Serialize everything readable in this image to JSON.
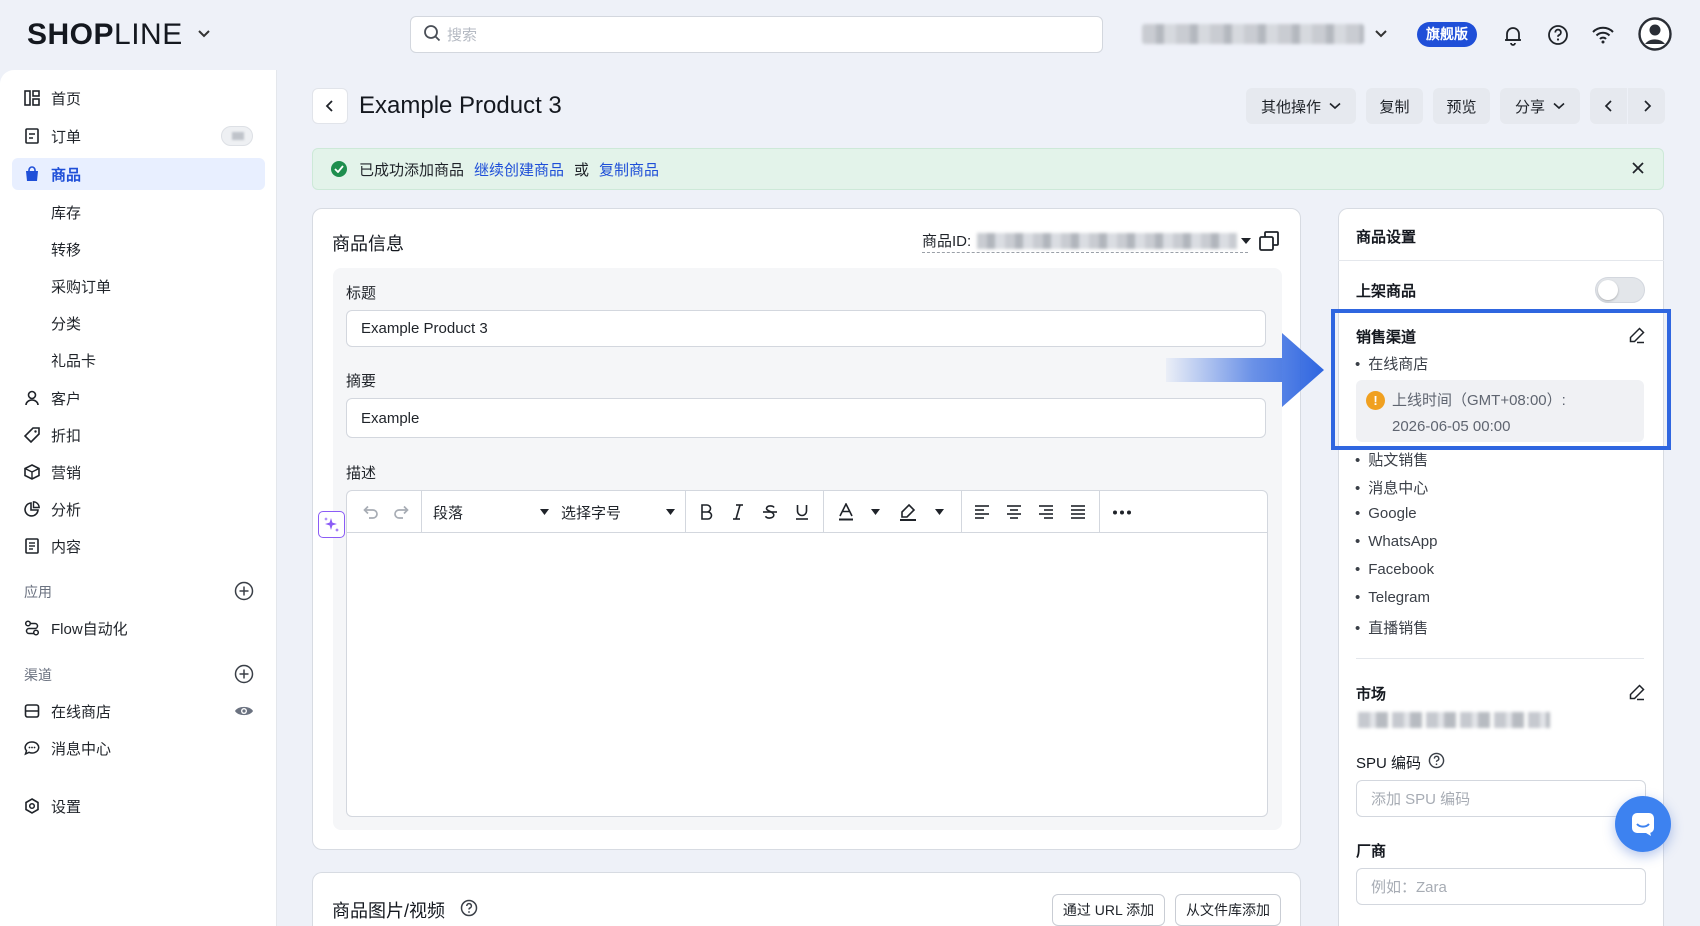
{
  "app": {
    "logo_bold": "SHOP",
    "logo_thin": "LINE",
    "search_placeholder": "搜索",
    "plan_badge": "旗舰版",
    "accent_color": "#1f4fd8"
  },
  "sidebar": {
    "items": [
      {
        "label": "首页",
        "icon": "grid-icon"
      },
      {
        "label": "订单",
        "icon": "order-icon"
      },
      {
        "label": "商品",
        "icon": "bag-icon"
      },
      {
        "label": "客户",
        "icon": "user-icon"
      },
      {
        "label": "折扣",
        "icon": "tag-icon"
      },
      {
        "label": "营销",
        "icon": "cube-icon"
      },
      {
        "label": "分析",
        "icon": "pie-icon"
      },
      {
        "label": "内容",
        "icon": "document-icon"
      }
    ],
    "product_sub": [
      "库存",
      "转移",
      "采购订单",
      "分类",
      "礼品卡"
    ],
    "apps_section": "应用",
    "flow_label": "Flow自动化",
    "channels_section": "渠道",
    "channels": [
      {
        "label": "在线商店"
      },
      {
        "label": "消息中心"
      }
    ],
    "settings_label": "设置"
  },
  "page": {
    "title": "Example Product 3",
    "actions": {
      "more": "其他操作",
      "duplicate": "复制",
      "preview": "预览",
      "share": "分享"
    },
    "banner": {
      "message": "已成功添加商品",
      "link_continue": "继续创建商品",
      "separator": "或",
      "link_copy": "复制商品"
    },
    "product_info": {
      "heading": "商品信息",
      "product_id_label": "商品ID:",
      "title_label": "标题",
      "title_value": "Example Product 3",
      "summary_label": "摘要",
      "summary_value": "Example",
      "description_label": "描述",
      "toolbar": {
        "paragraph": "段落",
        "font_size": "选择字号"
      }
    },
    "media": {
      "heading": "商品图片/视频",
      "add_url": "通过 URL 添加",
      "add_library": "从文件库添加"
    }
  },
  "settings_panel": {
    "heading": "商品设置",
    "publish_label": "上架商品",
    "publish_on": false,
    "sales_channels_label": "销售渠道",
    "online_store": "在线商店",
    "launch_time_label": "上线时间（GMT+08:00）:",
    "launch_time_value": "2026-06-05 00:00",
    "other_channels": [
      "贴文销售",
      "消息中心",
      "Google",
      "WhatsApp",
      "Facebook",
      "Telegram",
      "直播销售"
    ],
    "market_label": "市场",
    "spu_label": "SPU 编码",
    "spu_placeholder": "添加 SPU 编码",
    "vendor_label": "厂商",
    "vendor_placeholder": "例如：Zara"
  }
}
